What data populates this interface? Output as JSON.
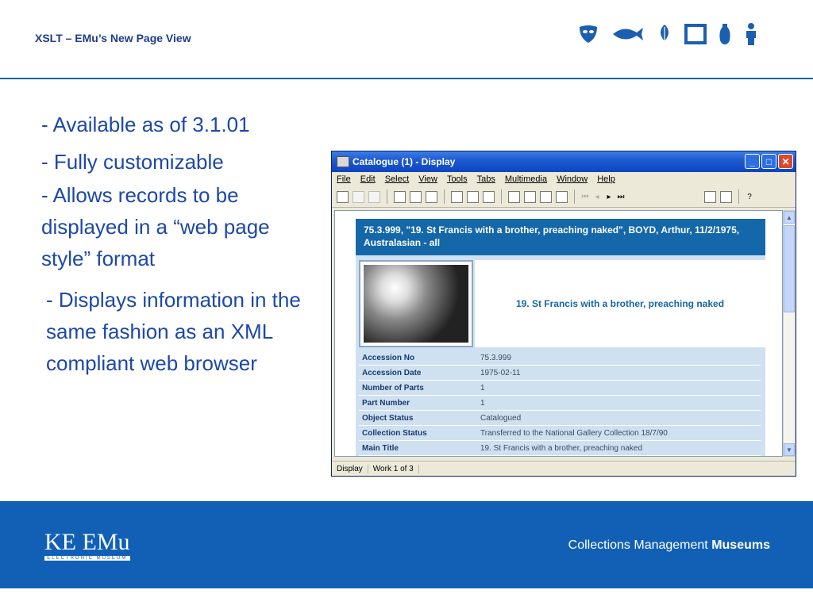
{
  "slide": {
    "title": "XSLT – EMu’s New Page View"
  },
  "header_icons": [
    "mask-icon",
    "fish-icon",
    "leaf-icon",
    "frame-icon",
    "vase-icon",
    "figurine-icon"
  ],
  "bullets": [
    "- Available as of 3.1.01",
    "- Fully customizable",
    "- Allows records to be displayed in a “web page style” format",
    "- Displays information in the same fashion as an XML compliant web browser"
  ],
  "window": {
    "title": "Catalogue (1) - Display",
    "menu": [
      "File",
      "Edit",
      "Select",
      "View",
      "Tools",
      "Tabs",
      "Multimedia",
      "Window",
      "Help"
    ],
    "status": [
      "Display",
      "Work 1 of 3"
    ]
  },
  "record": {
    "heading": "75.3.999, \"19. St Francis with a brother, preaching naked\", BOYD, Arthur, 11/2/1975, Australasian - all",
    "caption": "19. St Francis with a brother, preaching naked",
    "fields": [
      {
        "label": "Accession No",
        "value": "75.3.999"
      },
      {
        "label": "Accession Date",
        "value": "1975-02-11"
      },
      {
        "label": "Number of Parts",
        "value": "1"
      },
      {
        "label": "Part Number",
        "value": "1"
      },
      {
        "label": "Object Status",
        "value": "Catalogued"
      },
      {
        "label": "Collection Status",
        "value": "Transferred to the National Gallery Collection 18/7/90"
      },
      {
        "label": "Main Title",
        "value": "19. St Francis with a brother, preaching naked"
      }
    ]
  },
  "footer": {
    "logo": "KE EMu",
    "logo_sub": "ELECTRONIC MUSEUM",
    "tagline_normal": "Collections Management",
    "tagline_bold": "Museums"
  },
  "colors": {
    "accent": "#1d48a8",
    "footer": "#1160b5",
    "record_header": "#1467a9"
  }
}
